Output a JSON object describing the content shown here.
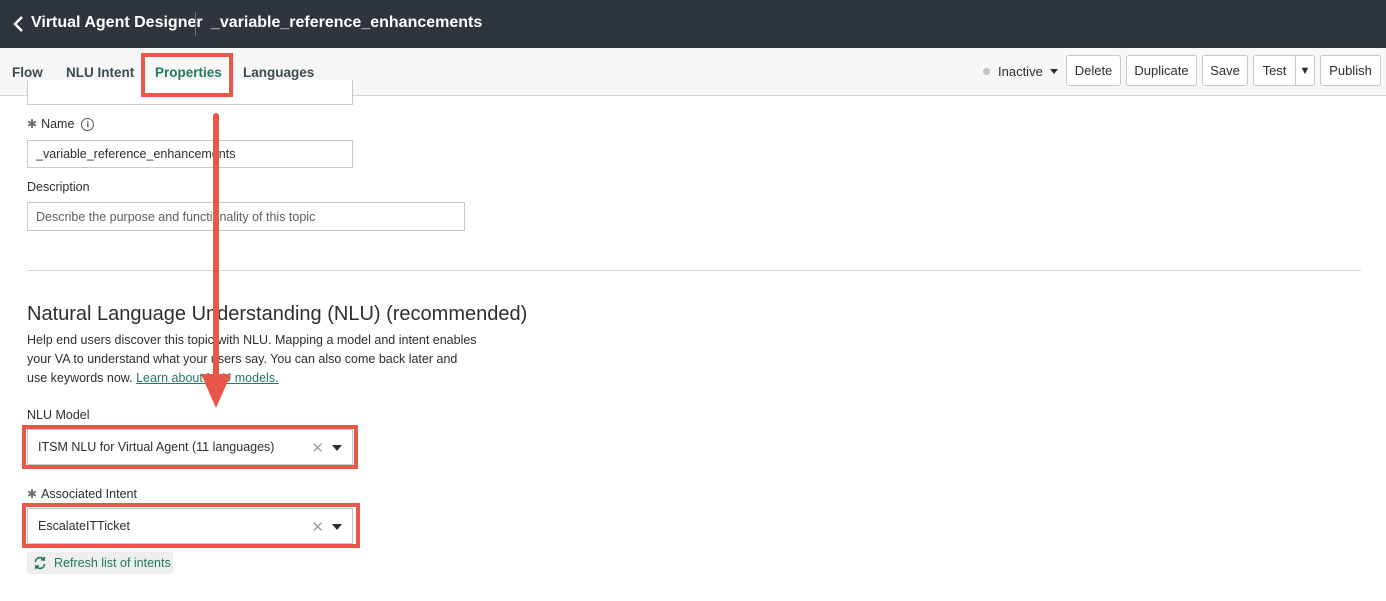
{
  "header": {
    "app_title": "Virtual Agent Designer",
    "doc_title": "_variable_reference_enhancements"
  },
  "tabs": [
    {
      "label": "Flow"
    },
    {
      "label": "NLU Intent"
    },
    {
      "label": "Properties",
      "active": true
    },
    {
      "label": "Languages"
    }
  ],
  "toolbar": {
    "status": "Inactive",
    "delete": "Delete",
    "duplicate": "Duplicate",
    "save": "Save",
    "test": "Test",
    "publish": "Publish"
  },
  "form": {
    "name_label": "Name",
    "name_value": "_variable_reference_enhancements",
    "description_label": "Description",
    "description_placeholder": "Describe the purpose and functionality of this topic"
  },
  "nlu": {
    "title": "Natural Language Understanding (NLU) (recommended)",
    "description": "Help end users discover this topic with NLU. Mapping a model and intent enables your VA to understand what your users say. You can also come back later and use keywords now.",
    "learn_link": "Learn about NLU models.",
    "model_label": "NLU Model",
    "model_value": "ITSM NLU for Virtual Agent (11 languages)",
    "intent_label": "Associated Intent",
    "intent_value": "EscalateITTicket",
    "refresh_label": "Refresh list of intents"
  },
  "colors": {
    "header_bg": "#2f353d",
    "accent": "#1f7a5e",
    "annotation": "#e8574a"
  },
  "icons": [
    "back-chevron-icon",
    "info-icon",
    "clear-icon",
    "dropdown-caret-icon",
    "refresh-icon"
  ]
}
